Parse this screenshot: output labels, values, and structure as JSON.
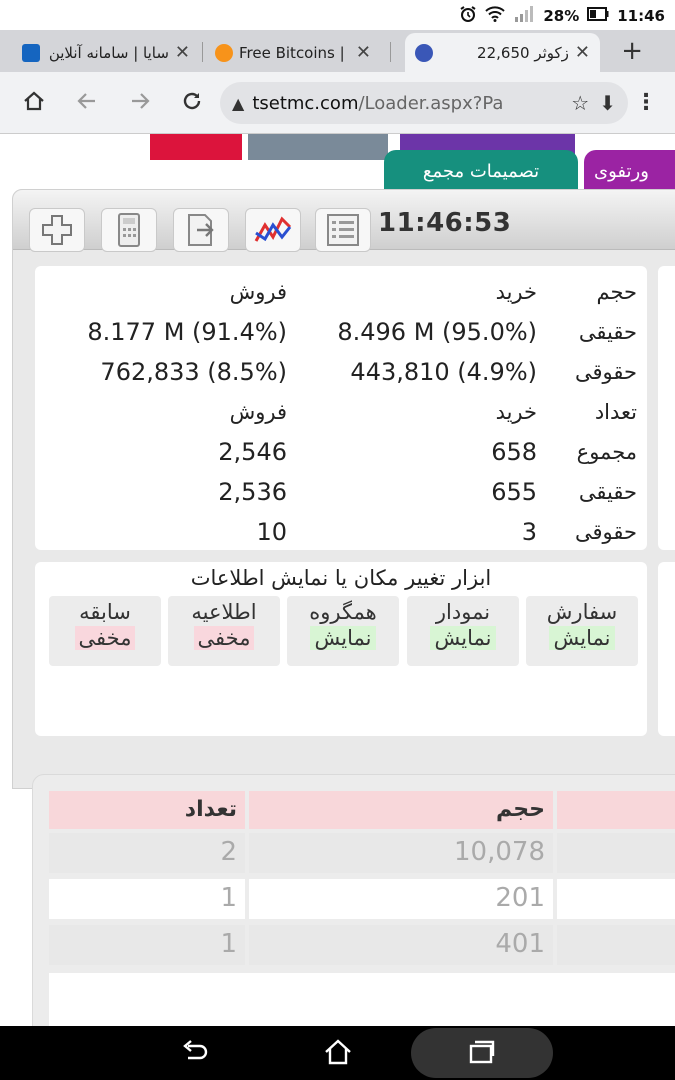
{
  "status_bar": {
    "battery": "28%",
    "time": "11:46"
  },
  "tabs": [
    {
      "title": "سایا | سامانه آنلاین",
      "fav_color": "#1565c0"
    },
    {
      "title": "Free Bitcoins |",
      "fav_color": "#f7931a"
    },
    {
      "title": "زکوثر 22,650",
      "fav_color": "#3a57b7"
    }
  ],
  "url": {
    "host": "tsetmc.com",
    "path": "/Loader.aspx?Pa"
  },
  "page_tabs": {
    "assembly": "تصمیمات مجمع",
    "portfolio": "ورتفوی"
  },
  "colors": {
    "stripe_red": "#dc143c",
    "stripe_gray": "#7a8a99",
    "stripe_purple": "#6c35a8",
    "tab_teal": "#16907e",
    "tab_purple": "#9b23a3"
  },
  "toolbar": {
    "clock": "11:46:53"
  },
  "trades": {
    "volume_label": "حجم",
    "buy_label": "خرید",
    "sell_label": "فروش",
    "real_label": "حقیقی",
    "legal_label": "حقوقی",
    "count_label": "تعداد",
    "total_label": "مجموع",
    "volume": {
      "real_buy": "8.496 M (95.0%)",
      "real_sell": "8.177 M (91.4%)",
      "legal_buy": "443,810 (4.9%)",
      "legal_sell": "762,833 (8.5%)"
    },
    "count": {
      "total_buy": "658",
      "total_sell": "2,546",
      "real_buy": "655",
      "real_sell": "2,536",
      "legal_buy": "3",
      "legal_sell": "10"
    }
  },
  "display_tools": {
    "title": "ابزار تغییر مکان یا نمایش اطلاعات",
    "options": [
      {
        "name": "سفارش",
        "state": "نمایش",
        "visible": true
      },
      {
        "name": "نمودار",
        "state": "نمایش",
        "visible": true
      },
      {
        "name": "همگروه",
        "state": "نمایش",
        "visible": true
      },
      {
        "name": "اطلاعیه",
        "state": "مخفی",
        "visible": false
      },
      {
        "name": "سابقه",
        "state": "مخفی",
        "visible": false
      }
    ]
  },
  "orders_table": {
    "headers": {
      "volume": "حجم",
      "count": "تعداد"
    },
    "rows": [
      {
        "volume": "10,078",
        "count": "2"
      },
      {
        "volume": "201",
        "count": "1"
      },
      {
        "volume": "401",
        "count": "1"
      }
    ]
  }
}
